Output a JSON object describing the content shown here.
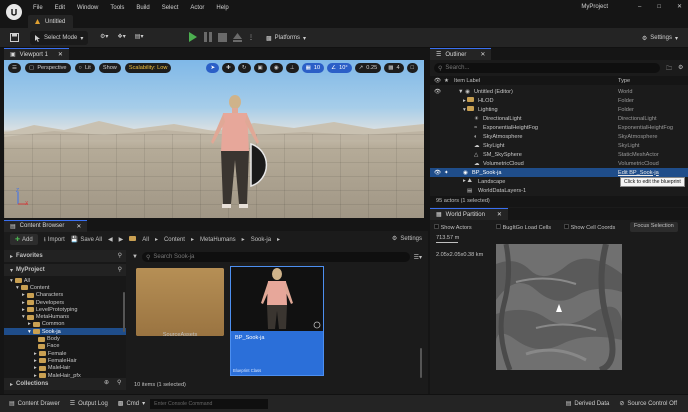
{
  "window": {
    "menu": [
      "File",
      "Edit",
      "Window",
      "Tools",
      "Build",
      "Select",
      "Actor",
      "Help"
    ],
    "doc_tab": "Untitled",
    "project_name": "MyProject"
  },
  "toolbar": {
    "select_mode": "Select Mode",
    "platforms": "Platforms",
    "settings": "Settings"
  },
  "viewport": {
    "tab": "Viewport 1",
    "perspective": "Perspective",
    "lit": "Lit",
    "show": "Show",
    "scalability": "Scalability: Low",
    "grid_snap": "10",
    "rot_snap": "10°",
    "scale_snap": "0.25",
    "camera_speed": "4",
    "axis_x": "X",
    "axis_z": "Z"
  },
  "outliner": {
    "tab": "Outliner",
    "search_placeholder": "Search...",
    "col_label": "Item Label",
    "col_type": "Type",
    "rows": [
      {
        "label": "Untitled (Editor)",
        "type": "World"
      },
      {
        "label": "HLOD",
        "type": "Folder"
      },
      {
        "label": "Lighting",
        "type": "Folder"
      },
      {
        "label": "DirectionalLight",
        "type": "DirectionalLight"
      },
      {
        "label": "ExponentialHeightFog",
        "type": "ExponentialHeightFog"
      },
      {
        "label": "SkyAtmosphere",
        "type": "SkyAtmosphere"
      },
      {
        "label": "SkyLight",
        "type": "SkyLight"
      },
      {
        "label": "SM_SkySphere",
        "type": "StaticMeshActor"
      },
      {
        "label": "VolumetricCloud",
        "type": "VolumetricCloud"
      },
      {
        "label": "BP_Sook-ja",
        "type": "Edit BP_Sook-ja"
      },
      {
        "label": "Landscape",
        "type": ""
      },
      {
        "label": "WorldDataLayers-1",
        "type": ""
      }
    ],
    "tooltip": "Click to edit the blueprint",
    "status": "95 actors (1 selected)"
  },
  "world_partition": {
    "tab": "World Partition",
    "show_actors": "Show Actors",
    "bugitgo": "BugItGo Load Cells",
    "show_cell_coords": "Show Cell Coords",
    "focus_selection": "Focus Selection",
    "scale_label": "713.57 m",
    "size_label": "2.05x2.05x0.38 km"
  },
  "content_browser": {
    "tab": "Content Browser",
    "add": "Add",
    "import": "Import",
    "save_all": "Save All",
    "path": [
      "All",
      "Content",
      "MetaHumans",
      "Sook-ja"
    ],
    "settings": "Settings",
    "favorites": "Favorites",
    "project": "MyProject",
    "search_placeholder": "Search Sook-ja",
    "tree": [
      {
        "label": "All",
        "depth": 0
      },
      {
        "label": "Content",
        "depth": 1
      },
      {
        "label": "Characters",
        "depth": 2
      },
      {
        "label": "Developers",
        "depth": 2
      },
      {
        "label": "LevelPrototyping",
        "depth": 2
      },
      {
        "label": "MetaHumans",
        "depth": 2
      },
      {
        "label": "Common",
        "depth": 3
      },
      {
        "label": "Sook-ja",
        "depth": 3
      },
      {
        "label": "Body",
        "depth": 4
      },
      {
        "label": "Face",
        "depth": 4
      },
      {
        "label": "Female",
        "depth": 4
      },
      {
        "label": "FemaleHair",
        "depth": 4
      },
      {
        "label": "MaleHair",
        "depth": 4
      },
      {
        "label": "MaleHair_pfx",
        "depth": 4
      }
    ],
    "collections": "Collections",
    "assets": [
      {
        "name": "SourceAssets",
        "class": ""
      },
      {
        "name": "BP_Sook-ja",
        "class": "Blueprint Class"
      }
    ],
    "item_count": "10 items (1 selected)"
  },
  "statusbar": {
    "content_drawer": "Content Drawer",
    "output_log": "Output Log",
    "cmd": "Cmd",
    "console_placeholder": "Enter Console Command",
    "derived_data": "Derived Data",
    "source_control": "Source Control Off"
  },
  "colors": {
    "accent": "#2b5fc7",
    "selection": "#1f4d8a",
    "play": "#4caf50",
    "folder": "#c9a052"
  }
}
